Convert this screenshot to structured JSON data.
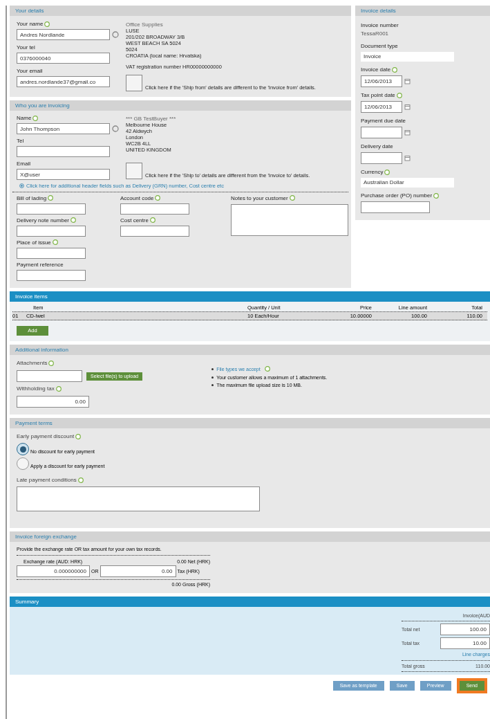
{
  "your_details": {
    "title": "Your details",
    "fields": [
      {
        "label": "Your name",
        "value": "Andres Nordlande",
        "info": true,
        "lookup": true
      },
      {
        "label": "Your tel",
        "value": "0376000040",
        "info": false,
        "lookup": false
      },
      {
        "label": "Your email",
        "value": "andres.nordlande37@gmail.co",
        "info": false,
        "lookup": false
      }
    ],
    "address": [
      "Office Supplies",
      "LUSE",
      "201/202 BROADWAY 3/B",
      "WEST BEACH SA 5024",
      "5024",
      "CROATIA (local name: Hrvatska)"
    ],
    "vat": "VAT registration number HR00000000000",
    "ship": {
      "checked": false,
      "label": "Click here if the 'Ship from' details are different to the 'Invoice from' details."
    }
  },
  "invoicing": {
    "title": "Who you are invoicing",
    "fields": [
      {
        "label": "Name",
        "value": "John Thompson",
        "info": true,
        "lookup": true
      },
      {
        "label": "Tel",
        "info": false,
        "lookup": false
      },
      {
        "label": "Email",
        "value": "X@user",
        "info": false,
        "lookup": false
      }
    ],
    "address": [
      "*** GB TestBuyer ***",
      "Melbourne House",
      "42 Aldwych",
      "London",
      "WC2B 4LL",
      "UNITED KINGDOM"
    ],
    "ship": {
      "checked": false,
      "label": "Click here if the 'Ship to' details are different from the 'Invoice to' details."
    },
    "more_link": "Click here for additional header fields such as Delivery (GRN) number, Cost centre etc",
    "header_fields": [
      {
        "label": "Bill of lading",
        "info": true
      },
      {
        "label": "Account code",
        "info": true
      },
      {
        "label": "Delivery note number",
        "info": true
      },
      {
        "label": "Cost centre",
        "info": true
      },
      {
        "label": "Place of issue",
        "info": true
      },
      {
        "label": "Payment reference",
        "info": false
      }
    ],
    "notes": {
      "label": "Notes to your customer",
      "info": true
    }
  },
  "invoice_details": {
    "title": "Invoice details",
    "number_label": "Invoice number",
    "number": "TessaR001",
    "fields": [
      {
        "kind": "plain",
        "label": "Document type",
        "value": "Invoice",
        "info": false
      },
      {
        "kind": "date",
        "label": "Invoice date",
        "value": "12/06/2013",
        "info": true
      },
      {
        "kind": "date",
        "label": "Tax point date",
        "value": "12/06/2013",
        "info": true
      },
      {
        "kind": "date",
        "label": "Payment due date",
        "info": false
      },
      {
        "kind": "date",
        "label": "Delivery date",
        "info": false
      },
      {
        "kind": "plain",
        "label": "Currency",
        "value": "Australian Dollar",
        "info": true
      },
      {
        "kind": "text",
        "label": "Purchase order (PO) number",
        "info": true
      }
    ]
  },
  "items": {
    "title": "Invoice items",
    "columns": [
      "Item",
      "Quantity / Unit",
      "Price",
      "Line amount",
      "Total"
    ],
    "rows": [
      {
        "number": "01",
        "cells": [
          "CD-Iwel",
          "10 Each/Hour",
          "10.00000",
          "100.00",
          "110.00"
        ]
      }
    ],
    "add_button": "Add"
  },
  "additional": {
    "title": "Additional information",
    "attachments_label": "Attachments",
    "upload_button": "Select file(s) to upload",
    "withholding_label": "Withholding tax",
    "withholding_value": "0.00",
    "file_types_link": "File types we accept",
    "notes": [
      "Your customer allows a maximum of 1 attachments.",
      "The maximum file upload size is 10 MB."
    ]
  },
  "payment_terms": {
    "title": "Payment terms",
    "discount_label": "Early payment discount",
    "options": [
      {
        "label": "No discount for early payment",
        "selected": true
      },
      {
        "label": "Apply a discount for early payment",
        "selected": false
      }
    ],
    "late_label": "Late payment conditions"
  },
  "exchange": {
    "title": "Invoice foreign exchange",
    "intro": "Provide the exchange rate OR tax amount for your own tax records.",
    "rate_label": "Exchange rate (AUD: HRK)",
    "net": "0.00 Net (HRK)",
    "rate_value": "0.000000000",
    "or": "OR",
    "tax_value": "0.00",
    "tax_label": "Tax (HRK)",
    "gross": "0.00 Gross (HRK)"
  },
  "summary": {
    "title": "Summary",
    "currency_label": "Invoice(AUD",
    "net_label": "Total net",
    "net_value": "100.00",
    "tax_label": "Total tax",
    "tax_value": "10.00",
    "line_charges": "Line charges",
    "gross_label": "Total gross",
    "gross_value": "110.00"
  },
  "buttons": [
    {
      "label": "Save as template",
      "kind": "secondary",
      "highlighted": false
    },
    {
      "label": "Save",
      "kind": "secondary",
      "highlighted": false
    },
    {
      "label": "Preview",
      "kind": "secondary",
      "highlighted": false
    },
    {
      "label": "Send",
      "kind": "primary",
      "highlighted": true
    }
  ]
}
